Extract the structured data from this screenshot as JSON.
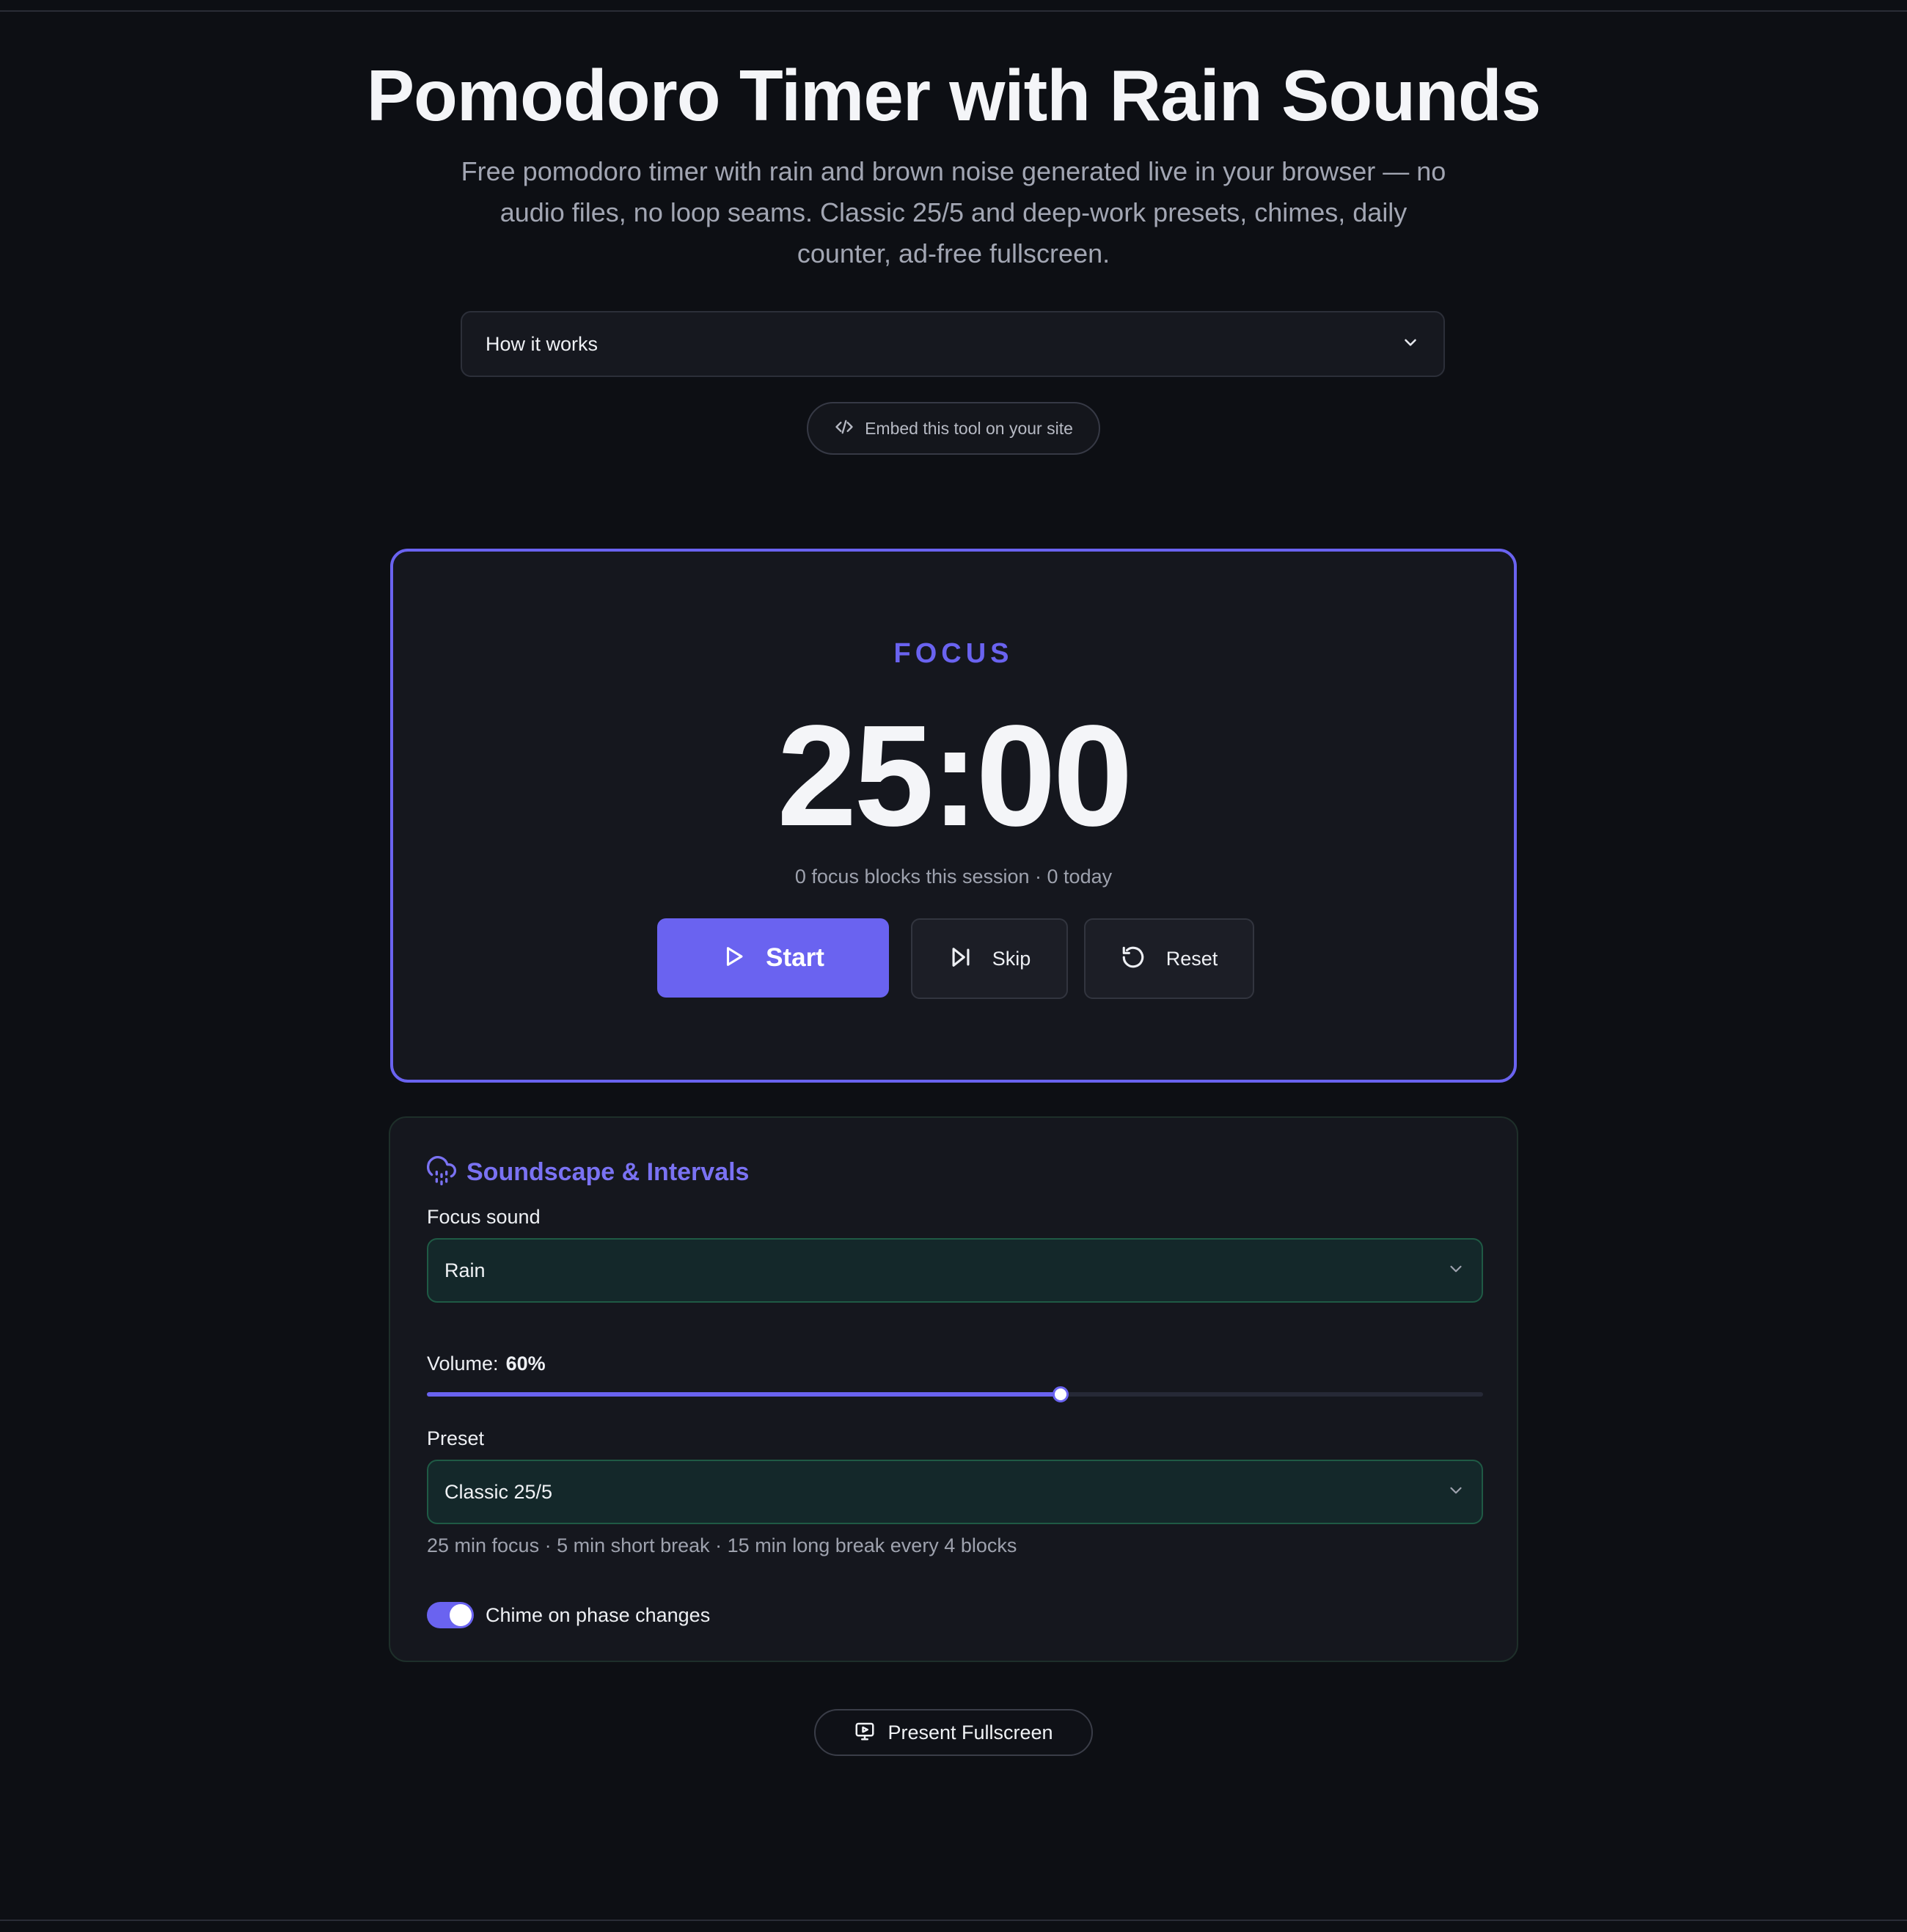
{
  "page": {
    "title": "Pomodoro Timer with Rain Sounds",
    "subtitle": "Free pomodoro timer with rain and brown noise generated live in your browser — no audio files, no loop seams. Classic 25/5 and deep-work presets, chimes, daily counter, ad-free fullscreen."
  },
  "howto": {
    "label": "How it works",
    "icon": "chevron-down-icon"
  },
  "embed": {
    "label": "Embed this tool on your site",
    "icon": "code-icon"
  },
  "timer": {
    "phase": "FOCUS",
    "time": "25:00",
    "counter": "0 focus blocks this session · 0 today",
    "buttons": {
      "start": "Start",
      "skip": "Skip",
      "reset": "Reset"
    }
  },
  "soundscape": {
    "title": "Soundscape & Intervals",
    "focus_sound_label": "Focus sound",
    "focus_sound_value": "Rain",
    "volume_label": "Volume:",
    "volume_value": "60%",
    "volume_fraction": 0.6,
    "preset_label": "Preset",
    "preset_value": "Classic 25/5",
    "preset_description": "25 min focus · 5 min short break · 15 min long break every 4 blocks",
    "chime_label": "Chime on phase changes",
    "chime_enabled": true
  },
  "present": {
    "label": "Present Fullscreen",
    "icon": "presentation-icon"
  },
  "colors": {
    "accent": "#6a63f0",
    "background": "#0d0f14",
    "card": "#15171e",
    "select_bg": "#14282a",
    "select_border": "#1f5a45"
  }
}
